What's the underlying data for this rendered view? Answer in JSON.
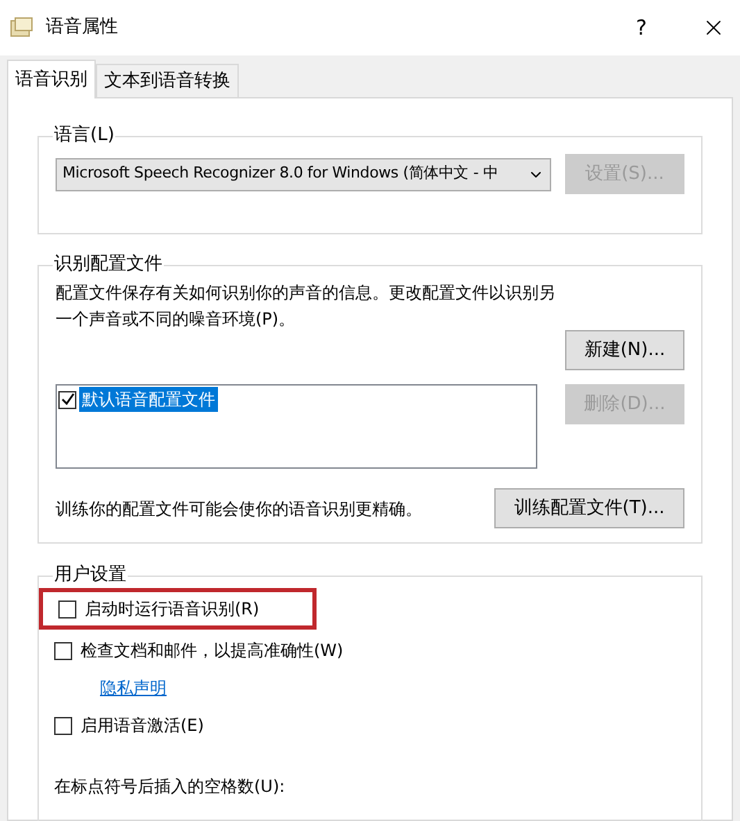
{
  "window": {
    "title": "语音属性",
    "help": "?"
  },
  "tabs": [
    {
      "label": "语音识别",
      "selected": true
    },
    {
      "label": "文本到语音转换",
      "selected": false
    }
  ],
  "language_group": {
    "title": "语言(L)",
    "dropdown_value": "Microsoft Speech Recognizer 8.0 for Windows (简体中文 - 中",
    "settings_button": {
      "label": "设置(S)...",
      "disabled": true
    }
  },
  "profile_group": {
    "title": "识别配置文件",
    "description": "配置文件保存有关如何识别你的声音的信息。更改配置文件以识别另一个声音或不同的噪音环境(P)。",
    "new_button": {
      "label": "新建(N)...",
      "disabled": false
    },
    "delete_button": {
      "label": "删除(D)...",
      "disabled": true
    },
    "profiles": [
      {
        "label": "默认语音配置文件",
        "checked": true,
        "selected": true
      }
    ],
    "training_text": "训练你的配置文件可能会使你的语音识别更精确。",
    "training_button": {
      "label": "训练配置文件(T)...",
      "disabled": false
    }
  },
  "user_settings": {
    "title": "用户设置",
    "items": [
      {
        "kind": "checkbox",
        "label": "启动时运行语音识别(R)",
        "checked": false,
        "highlighted": true
      },
      {
        "kind": "checkbox",
        "label": "检查文档和邮件，以提高准确性(W)",
        "checked": false,
        "highlighted": false
      },
      {
        "kind": "link",
        "label": "隐私声明"
      },
      {
        "kind": "checkbox",
        "label": "启用语音激活(E)",
        "checked": false,
        "highlighted": false
      }
    ],
    "spaces_label": "在标点符号后插入的空格数(U):"
  }
}
